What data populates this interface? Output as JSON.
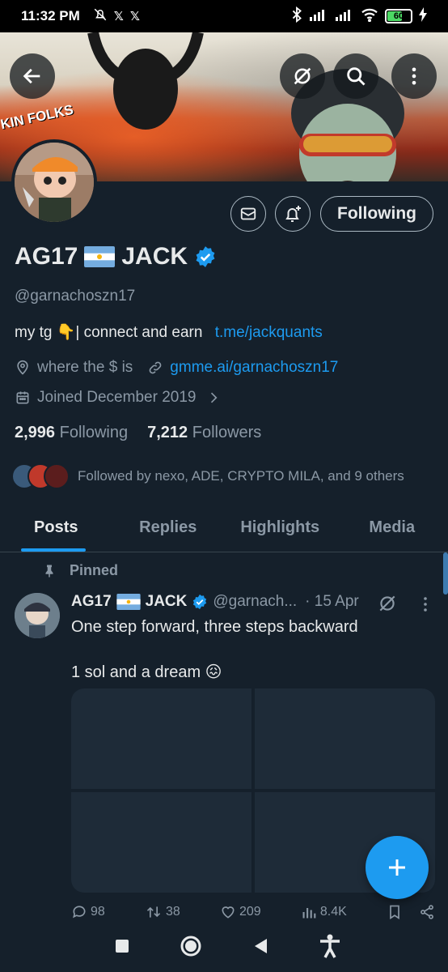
{
  "status_bar": {
    "time": "11:32 PM",
    "battery": "60"
  },
  "banner": {
    "tag": "KIN FOLKS"
  },
  "profile": {
    "name": "AG17",
    "name_suffix": "JACK",
    "handle": "@garnachoszn17",
    "bio_text": "my tg 👇| connect and earn",
    "bio_link": "t.me/jackquants",
    "location": "where the $ is",
    "website": "gmme.ai/garnachoszn17",
    "joined": "Joined December 2019",
    "following_count": "2,996",
    "following_label": "Following",
    "followers_count": "7,212",
    "followers_label": "Followers",
    "followed_by": "Followed by nexo, ADE, CRYPTO MILA, and 9 others",
    "following_button": "Following"
  },
  "tabs": [
    {
      "label": "Posts",
      "active": true
    },
    {
      "label": "Replies",
      "active": false
    },
    {
      "label": "Highlights",
      "active": false
    },
    {
      "label": "Media",
      "active": false
    }
  ],
  "post": {
    "pinned_label": "Pinned",
    "name": "AG17",
    "name_suffix": "JACK",
    "handle": "@garnach...",
    "date": "· 15 Apr",
    "line1": "One step forward, three steps backward",
    "line2": "1 sol and a dream 😖",
    "replies": "98",
    "reposts": "38",
    "likes": "209",
    "views": "8.4K"
  },
  "colors": {
    "background": "#15202b",
    "accent": "#1d9bf0",
    "muted": "#8b98a5"
  }
}
